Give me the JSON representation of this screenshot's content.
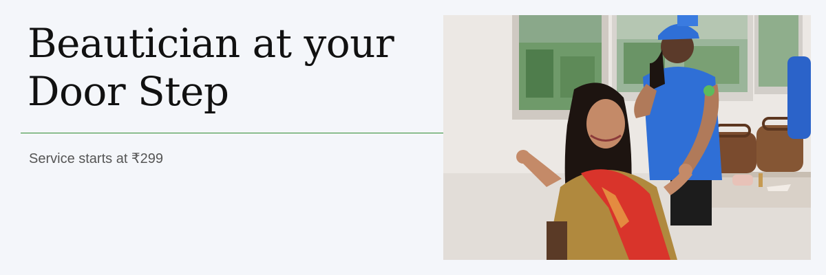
{
  "headline": {
    "line1": "Beautician at your",
    "line2": "Door Step"
  },
  "subtext": "Service starts at ₹299",
  "colors": {
    "background": "#f4f6fa",
    "divider": "#2e8b2e",
    "headline": "#111111",
    "subtext": "#555555"
  }
}
